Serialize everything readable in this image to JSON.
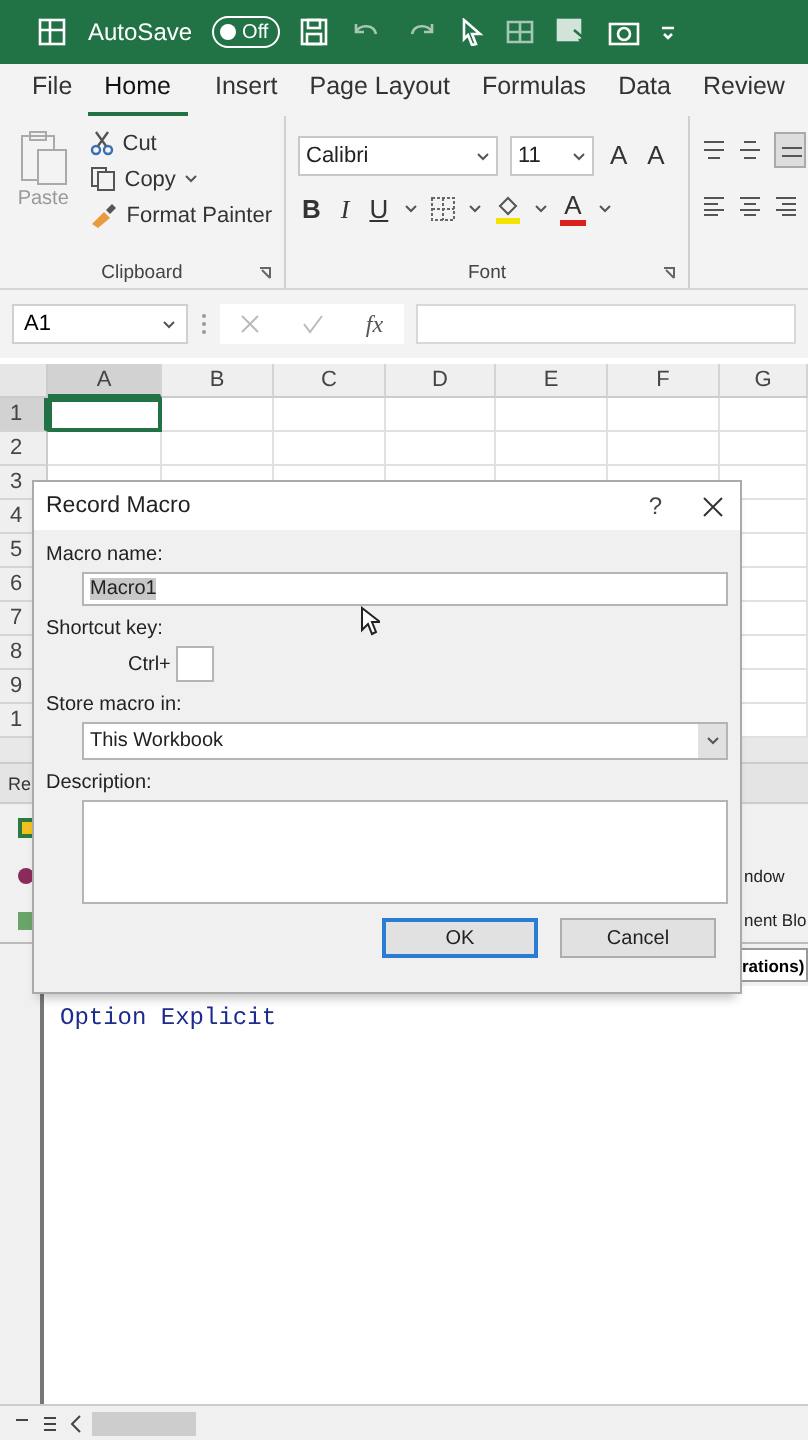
{
  "title_bar": {
    "autosave_label": "AutoSave",
    "autosave_toggle": {
      "label": "Off",
      "on": false
    }
  },
  "ribbon_tabs": [
    {
      "label": "File",
      "selected": false
    },
    {
      "label": "Home",
      "selected": true
    },
    {
      "label": "Insert",
      "selected": false
    },
    {
      "label": "Page Layout",
      "selected": false
    },
    {
      "label": "Formulas",
      "selected": false
    },
    {
      "label": "Data",
      "selected": false
    },
    {
      "label": "Review",
      "selected": false
    }
  ],
  "clipboard_group": {
    "paste": "Paste",
    "cut": "Cut",
    "copy": "Copy",
    "format_painter": "Format Painter",
    "label": "Clipboard"
  },
  "font_group": {
    "font": "Calibri",
    "size": "11",
    "grow_font": "A",
    "shrink_font": "A",
    "bold": "B",
    "italic": "I",
    "underline": "U",
    "font_color": "A",
    "label": "Font"
  },
  "formula_bar": {
    "name_box": "A1",
    "function_label": "fx"
  },
  "sheet": {
    "columns": [
      {
        "label": "A",
        "selected": true
      },
      {
        "label": "B",
        "selected": false
      },
      {
        "label": "C",
        "selected": false
      },
      {
        "label": "D",
        "selected": false
      },
      {
        "label": "E",
        "selected": false
      },
      {
        "label": "F",
        "selected": false
      },
      {
        "label": "G",
        "selected": false
      }
    ],
    "rows": [
      {
        "label": "1",
        "selected": true
      },
      {
        "label": "2",
        "selected": false
      },
      {
        "label": "3",
        "selected": false
      },
      {
        "label": "4",
        "selected": false
      },
      {
        "label": "5",
        "selected": false
      },
      {
        "label": "6",
        "selected": false
      },
      {
        "label": "7",
        "selected": false
      },
      {
        "label": "8",
        "selected": false
      },
      {
        "label": "9",
        "selected": false
      },
      {
        "label": "1",
        "selected": false
      }
    ]
  },
  "vba_editor": {
    "window_title": "Re",
    "menu_text": "ndow",
    "toolbar_text": "nent Blo",
    "procedure_dropdown": "rations)",
    "code": "Option Explicit"
  },
  "dialog": {
    "title": "Record Macro",
    "help": "?",
    "macro_name_label": "Macro name:",
    "macro_name": "Macro1",
    "shortcut_label": "Shortcut key:",
    "ctrl_label": "Ctrl+",
    "store_label": "Store macro in:",
    "store_value": "This Workbook",
    "description_label": "Description:",
    "ok": "OK",
    "cancel": "Cancel"
  }
}
